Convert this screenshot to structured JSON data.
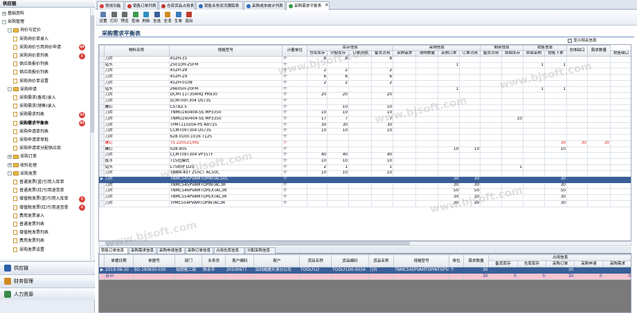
{
  "sidebar": {
    "header": "供应链",
    "tree": [
      {
        "label": "基础资料",
        "level": 0,
        "type": "node",
        "expand": "+"
      },
      {
        "label": "采购管理",
        "level": 0,
        "type": "node",
        "expand": "-"
      },
      {
        "label": "询价与定价",
        "level": 1,
        "type": "folder",
        "expand": "-"
      },
      {
        "label": "采购询价单录入",
        "level": 2,
        "type": "doc"
      },
      {
        "label": "采购询价引用询价申请",
        "level": 2,
        "type": "doc",
        "badge": "48"
      },
      {
        "label": "采购询价单列表",
        "level": 2,
        "type": "doc",
        "badge": "1"
      },
      {
        "label": "供应商报价列表",
        "level": 2,
        "type": "doc"
      },
      {
        "label": "供应商报价列表",
        "level": 2,
        "type": "doc"
      },
      {
        "label": "采购询价单设置",
        "level": 2,
        "type": "doc"
      },
      {
        "label": "采购申请",
        "level": 1,
        "type": "folder",
        "expand": "-"
      },
      {
        "label": "采购需求(备库)录入",
        "level": 2,
        "type": "doc"
      },
      {
        "label": "采购需求(销售)录入",
        "level": 2,
        "type": "doc"
      },
      {
        "label": "采购需求列表",
        "level": 2,
        "type": "doc",
        "badge": "32"
      },
      {
        "label": "采购需求平衡表",
        "level": 2,
        "type": "doc",
        "badge": "83",
        "active": true
      },
      {
        "label": "采购申请单列表",
        "level": 2,
        "type": "doc"
      },
      {
        "label": "采购申请单审批",
        "level": 2,
        "type": "doc"
      },
      {
        "label": "采购申请单分配供应商",
        "level": 2,
        "type": "doc"
      },
      {
        "label": "采购订单",
        "level": 1,
        "type": "folder",
        "expand": "+"
      },
      {
        "label": "收料处理",
        "level": 1,
        "type": "folder",
        "expand": "+"
      },
      {
        "label": "采购发票",
        "level": 1,
        "type": "folder",
        "expand": "-"
      },
      {
        "label": "普通发票(蓝)引用入库单",
        "level": 2,
        "type": "doc"
      },
      {
        "label": "普通发票(红)引用退货单",
        "level": 2,
        "type": "doc"
      },
      {
        "label": "增值税发票(蓝)引用入库单",
        "level": 2,
        "type": "doc",
        "badge": "1"
      },
      {
        "label": "增值税发票(红)引用退货单",
        "level": 2,
        "type": "doc",
        "badge": "2"
      },
      {
        "label": "费用发票录入",
        "level": 2,
        "type": "doc"
      },
      {
        "label": "普通发票列表",
        "level": 2,
        "type": "doc"
      },
      {
        "label": "增值税发票列表",
        "level": 2,
        "type": "doc"
      },
      {
        "label": "费用发票列表",
        "level": 2,
        "type": "doc"
      },
      {
        "label": "采购发票设置",
        "level": 2,
        "type": "doc"
      }
    ],
    "nav": [
      {
        "label": "供应链",
        "color": "#2d5fa8"
      },
      {
        "label": "财务管理",
        "color": "#d08a20"
      },
      {
        "label": "人力资源",
        "color": "#3a8a4a"
      }
    ]
  },
  "tabs": [
    {
      "label": "常用功能",
      "color": "#d9403a",
      "active": false
    },
    {
      "label": "销售订单列表",
      "color": "#c0392b",
      "active": false
    },
    {
      "label": "仓库货品占用表",
      "color": "#c0392b",
      "active": false
    },
    {
      "label": "销售业务状况跟踪表",
      "color": "#2d6fbf",
      "active": false
    },
    {
      "label": "采购成本统计列表",
      "color": "#2d6fbf",
      "active": false
    },
    {
      "label": "采购需求平衡表",
      "color": "#3a9a4a",
      "active": true
    }
  ],
  "tab_close": "×",
  "toolbar": [
    {
      "label": "设置",
      "icon": "settings-icon",
      "color": "#5b7fb0"
    },
    {
      "label": "打印",
      "icon": "print-icon",
      "color": "#6a6a6a"
    },
    {
      "label": "预览",
      "icon": "preview-icon",
      "color": "#6a6a6a"
    },
    {
      "label": "查询",
      "icon": "search-icon",
      "color": "#3a9a4a"
    },
    {
      "label": "刷新",
      "icon": "refresh-icon",
      "color": "#2d8fbf"
    },
    {
      "label": "全选",
      "icon": "select-all-icon",
      "color": "#3a5f98"
    },
    {
      "label": "全消",
      "icon": "deselect-all-icon",
      "color": "#d08a20"
    },
    {
      "label": "生单",
      "icon": "generate-order-icon",
      "color": "#3a7ab8"
    },
    {
      "label": "退出",
      "icon": "exit-icon",
      "color": "#c0392b"
    }
  ],
  "page_title": "采购需求平衡表",
  "show_related": {
    "label": "显示相关信息",
    "checked": true
  },
  "grid": {
    "group_headers": [
      "库存信息",
      "采购信息",
      "剩余信息",
      "销售信息"
    ],
    "columns": [
      "物料名称",
      "规格型号",
      "计量单位",
      "仓库库存",
      "分配库存",
      "订单占用",
      "备货占用",
      "采购需求",
      "请购数量",
      "采购订单",
      "订单占用",
      "备货占用",
      "自由库存",
      "自由采购",
      "销售下单",
      "销售缺口",
      "总体缺口",
      "需求数量"
    ],
    "rows": [
      [
        "刀片",
        "452H-31",
        "个",
        "8",
        "8",
        "",
        "8",
        "",
        "",
        "",
        "",
        "",
        "",
        "",
        "",
        "",
        "",
        ""
      ],
      [
        "钻头",
        "25010H-25FM",
        "个",
        "",
        "",
        "",
        "",
        "",
        "",
        "1",
        "",
        "",
        "",
        "1",
        "1",
        "",
        "",
        ""
      ],
      [
        "刀片",
        "452H-28",
        "个",
        "2",
        "2",
        "",
        "2",
        "",
        "",
        "",
        "",
        "",
        "",
        "",
        "",
        "",
        "",
        ""
      ],
      [
        "刀片",
        "452H-29",
        "个",
        "6",
        "6",
        "",
        "6",
        "",
        "",
        "",
        "",
        "",
        "",
        "",
        "",
        "",
        "",
        ""
      ],
      [
        "刀片",
        "452H-0108",
        "个",
        "2",
        "2",
        "",
        "2",
        "",
        "",
        "",
        "",
        "",
        "",
        "",
        "",
        "",
        "",
        ""
      ],
      [
        "钻头",
        "26605H-20FM",
        "个",
        "",
        "",
        "",
        "",
        "",
        "",
        "1",
        "",
        "",
        "",
        "1",
        "1",
        "",
        "",
        ""
      ],
      [
        "刀片",
        "DCMT11T304HQ PR930",
        "个",
        "20",
        "20",
        "",
        "20",
        "",
        "",
        "",
        "",
        "",
        "",
        "",
        "",
        "",
        "",
        ""
      ],
      [
        "刀片",
        "SCMT09T304 US735",
        "个",
        "",
        "",
        "",
        "",
        "",
        "",
        "",
        "",
        "",
        "",
        "",
        "",
        "",
        "",
        ""
      ],
      [
        "螺钉",
        "CSTB2.5",
        "个",
        "",
        "10",
        "",
        "10",
        "",
        "",
        "",
        "",
        "",
        "",
        "",
        "",
        "",
        "",
        ""
      ],
      [
        "刀片",
        "TNMG160408-SS MP3350",
        "个",
        "10",
        "10",
        "",
        "10",
        "",
        "",
        "",
        "",
        "",
        "",
        "",
        "",
        "",
        "",
        ""
      ],
      [
        "刀片",
        "TNMG160404-SS MP3350",
        "个",
        "17",
        "7",
        "",
        "7",
        "",
        "",
        "",
        "",
        "",
        "10",
        "",
        "",
        "",
        "",
        ""
      ],
      [
        "刀片",
        "TPMT110204-PS AH725",
        "个",
        "30",
        "30",
        "",
        "30",
        "",
        "",
        "",
        "",
        "",
        "",
        "",
        "",
        "",
        "",
        ""
      ],
      [
        "刀片",
        "CCMT09T304 US735",
        "个",
        "10",
        "10",
        "",
        "10",
        "",
        "",
        "",
        "",
        "",
        "",
        "",
        "",
        "",
        "",
        ""
      ],
      [
        "刀片",
        "628.0100.1016 T125",
        "个",
        "",
        "",
        "",
        "",
        "",
        "",
        "",
        "",
        "",
        "",
        "",
        "",
        "",
        "",
        ""
      ],
      [
        "螺钉",
        "TS 220521/HG",
        "个",
        "",
        "",
        "",
        "",
        "",
        "",
        "",
        "",
        "",
        "",
        "",
        "30",
        "30",
        "30",
        ""
      ],
      [
        "螺钉",
        "028-905",
        "个",
        "",
        "",
        "",
        "",
        "",
        "",
        "10",
        "10",
        "",
        "",
        "",
        "10",
        "",
        "",
        ""
      ],
      [
        "刀片",
        "CCMT09T304 VP15TF",
        "个",
        "40",
        "40",
        "",
        "40",
        "",
        "",
        "",
        "",
        "",
        "",
        "",
        "",
        "",
        "",
        ""
      ],
      [
        "扳手",
        "T15拉膜式",
        "个",
        "10",
        "10",
        "",
        "10",
        "",
        "",
        "",
        "",
        "",
        "",
        "",
        "",
        "",
        "",
        ""
      ],
      [
        "钻头",
        "L7580P D21",
        "个",
        "2",
        "1",
        "",
        "1",
        "",
        "",
        "",
        "",
        "",
        "1",
        "",
        "",
        "",
        "",
        ""
      ],
      [
        "刀片",
        "TNMA 43T 255CT AC50C",
        "个",
        "10",
        "10",
        "",
        "10",
        "",
        "",
        "",
        "",
        "",
        "",
        "",
        "",
        "",
        "",
        ""
      ],
      [
        "刀片",
        "TNMC545PVAMTOPINTAC50C",
        "个",
        "",
        "",
        "",
        "",
        "",
        "",
        "30",
        "30",
        "",
        "",
        "",
        "30",
        "",
        "",
        ""
      ],
      [
        "刀片",
        "TNMC545PVAMTOPINTAC3R",
        "个",
        "",
        "",
        "",
        "",
        "",
        "",
        "30",
        "30",
        "",
        "",
        "",
        "30",
        "",
        "",
        ""
      ],
      [
        "刀片",
        "TNMC546PVAMTOPEXTAC3R",
        "个",
        "",
        "",
        "",
        "",
        "",
        "",
        "50",
        "50",
        "",
        "",
        "",
        "50",
        "",
        "",
        ""
      ],
      [
        "刀片",
        "TNMC554PVAMTOPEXTAC3R",
        "个",
        "",
        "",
        "",
        "",
        "",
        "",
        "30",
        "30",
        "",
        "",
        "",
        "30",
        "",
        "",
        ""
      ],
      [
        "刀片",
        "TPMC554PVAMTOPINTAC3R",
        "个",
        "",
        "",
        "",
        "",
        "",
        "",
        "30",
        "30",
        "",
        "",
        "",
        "30",
        "",
        "",
        ""
      ]
    ],
    "red_row_index": 14,
    "selected_row_index": 20
  },
  "bottom_tabs": [
    "销售订单信息",
    "采购需求信息",
    "采购申请信息",
    "采购订单信息",
    "占用仓库信息",
    "分配采购信息"
  ],
  "bottom_grid": {
    "group_header": "占用信息",
    "columns": [
      "单据日期",
      "单据号",
      "部门",
      "业务员",
      "客户编码",
      "客户",
      "货品名称",
      "货品编码",
      "货品名称",
      "规格型号",
      "单位",
      "需求数量",
      "备货库存",
      "仓库库存",
      "采购订单",
      "采购申请",
      "采购需求"
    ],
    "rows": [
      [
        "2019-08-30",
        "SO-190830-030",
        "BJ销售二部",
        "陈永平",
        "20100677",
        "深圳威顺天津分公司",
        "TOOLFLO",
        "TOOLFLO0-0034",
        "刀片",
        "TNMC545PVAMTOPINTGP50C",
        "个",
        "30",
        "",
        "",
        "30",
        "",
        ""
      ]
    ],
    "total_label": "合计:",
    "totals": [
      "30",
      "0",
      "0",
      "30",
      "0",
      "0"
    ]
  },
  "watermark": "www.bjsoft.com"
}
